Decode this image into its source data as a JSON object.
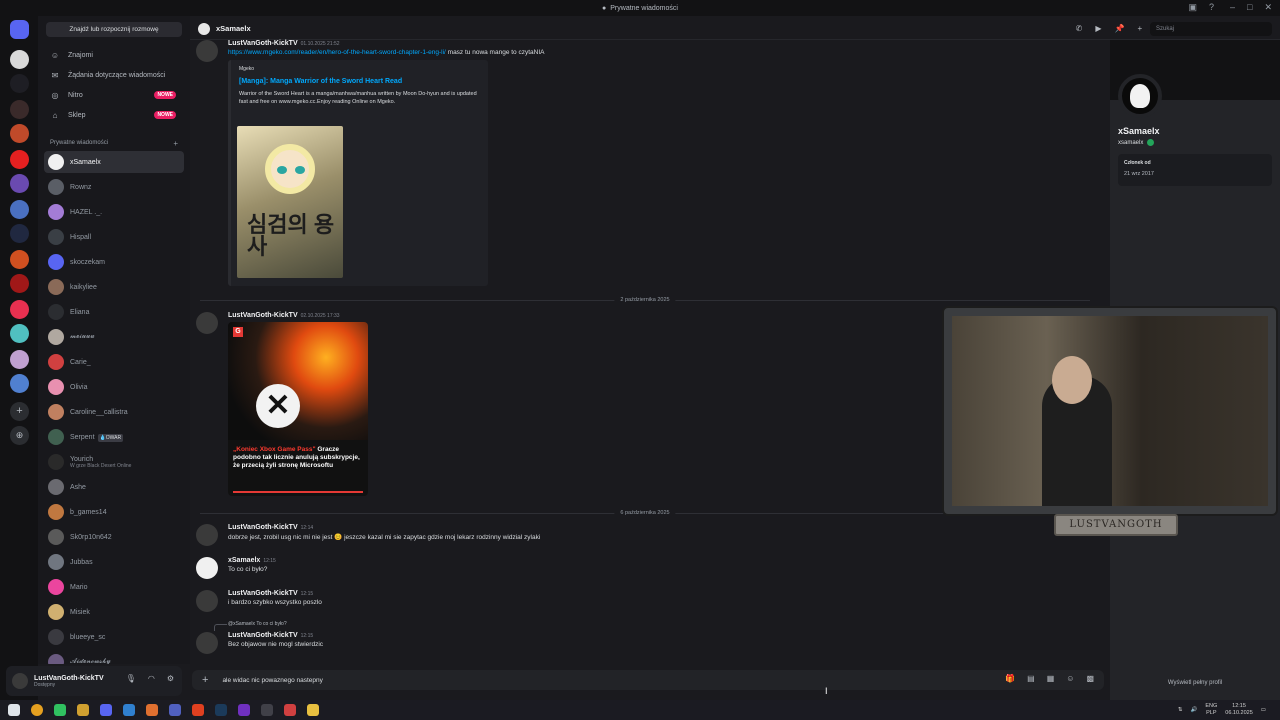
{
  "window": {
    "title": "Prywatne wiadomości"
  },
  "sidebar": {
    "find_button": "Znajdź lub rozpocznij rozmowę",
    "nav": [
      {
        "label": "Znajomi",
        "icon": "friends-icon"
      },
      {
        "label": "Żądania dotyczące wiadomości",
        "icon": "envelope-icon"
      },
      {
        "label": "Nitro",
        "icon": "nitro-icon",
        "badge": "NOWE"
      },
      {
        "label": "Sklep",
        "icon": "shop-icon",
        "badge": "NOWE"
      }
    ],
    "dm_header": "Prywatne wiadomości",
    "dms": [
      {
        "name": "xSamaelx",
        "color": "#f0f0f0",
        "active": true
      },
      {
        "name": "Rownz",
        "color": "#5a5e66"
      },
      {
        "name": "HAZEL ._.",
        "color": "#a37cd6"
      },
      {
        "name": "Hispall",
        "color": "#3a3f45"
      },
      {
        "name": "skoczekam",
        "color": "#5865f2"
      },
      {
        "name": "kaikyliee",
        "color": "#8a6a58"
      },
      {
        "name": "Eliana",
        "color": "#2b2d31"
      },
      {
        "name": "𝓶𝓮𝓲𝓾𝓾𝓾",
        "color": "#b0a8a0"
      },
      {
        "name": "Carie_",
        "color": "#d04040"
      },
      {
        "name": "Olivia",
        "color": "#e890b0"
      },
      {
        "name": "Caroline__callistra",
        "color": "#c08060"
      },
      {
        "name": "Serpent",
        "color": "#406050",
        "tag": "💧OWAR"
      },
      {
        "name": "Yourich",
        "color": "#2a2a2a",
        "sub": "W grze Black Desert Online"
      },
      {
        "name": "Ashe",
        "color": "#6a6a70"
      },
      {
        "name": "b_games14",
        "color": "#c07840"
      },
      {
        "name": "Sk0rp10n642",
        "color": "#5a5a5a"
      },
      {
        "name": "Jubbas",
        "color": "#707680"
      },
      {
        "name": "Mario",
        "color": "#eb459e"
      },
      {
        "name": "Misiek",
        "color": "#d0b070"
      },
      {
        "name": "blueeye_sc",
        "color": "#3a3a40"
      },
      {
        "name": "𝓐𝓲𝓭𝓮𝓷𝓸𝔀𝓼𝓴𝔂",
        "color": "#6a5a80"
      }
    ],
    "user": {
      "name": "LustVanGoth-KickTV",
      "status": "Dostępny"
    }
  },
  "chat": {
    "recipient": "xSamaelx",
    "search_placeholder": "Szukaj",
    "first": {
      "author": "LustVanGoth-KickTV",
      "time": "01.10.2025 21:52",
      "link": "https://www.mgeko.com/reader/en/hero-of-the-heart-sword-chapter-1-eng-li/",
      "after_link": " masz tu nowa mange to czytaNIA",
      "embed_provider": "Mgeko",
      "embed_title": "[Manga]: Manga Warrior of the Sword Heart Read",
      "embed_desc": "Warrior of the Sword Heart is a manga/manhwa/manhua written by Moon Do-hyun and is updated fast and free on www.mgeko.cc.Enjoy reading Online on Mgeko.",
      "cover_text": "심검의 용사"
    },
    "divider1": "2 października 2025",
    "second": {
      "author": "LustVanGoth-KickTV",
      "time": "02.10.2025 17:33",
      "news_badge": "G",
      "news_red": "„Koniec Xbox Game Pass\"",
      "news_white": " Gracze podobno tak licznie anulują subskrypcje, że przecią żyli stronę Microsoftu"
    },
    "divider2": "6 października 2025",
    "messages": [
      {
        "author": "LustVanGoth-KickTV",
        "time": "12:14",
        "text": "dobrze jest, zrobil usg nic mi nie jest 😊 jeszcze kazal mi sie zapytac gdzie moj lekarz rodzinny widzial zylaki"
      },
      {
        "author": "xSamaelx",
        "time": "12:15",
        "text": "To co ci było?"
      },
      {
        "author": "LustVanGoth-KickTV",
        "time": "12:15",
        "text": "i bardzo szybko wszystko poszlo"
      },
      {
        "author": "LustVanGoth-KickTV",
        "time": "12:15",
        "text": "Bez objawow nie mogl stwierdzic",
        "reply": "@xSamaelx To co ci było?"
      }
    ],
    "composer_value": "ale widac nic powaznego nastepny"
  },
  "profile": {
    "display_name": "xSamaelx",
    "username": "xsamaelx",
    "member_label": "Członek od",
    "member_since": "21 wrz 2017",
    "full_profile_button": "Wyświetl pełny profil"
  },
  "overlay": {
    "cam_label": "LUSTVANGOTH"
  },
  "taskbar": {
    "lang": "ENG",
    "layout": "PLP",
    "time": "12:15",
    "date": "06.10.2025"
  },
  "colors": {
    "accent": "#5865f2",
    "link": "#00a8fc",
    "new_badge": "#e91e63",
    "online": "#23a55a"
  }
}
